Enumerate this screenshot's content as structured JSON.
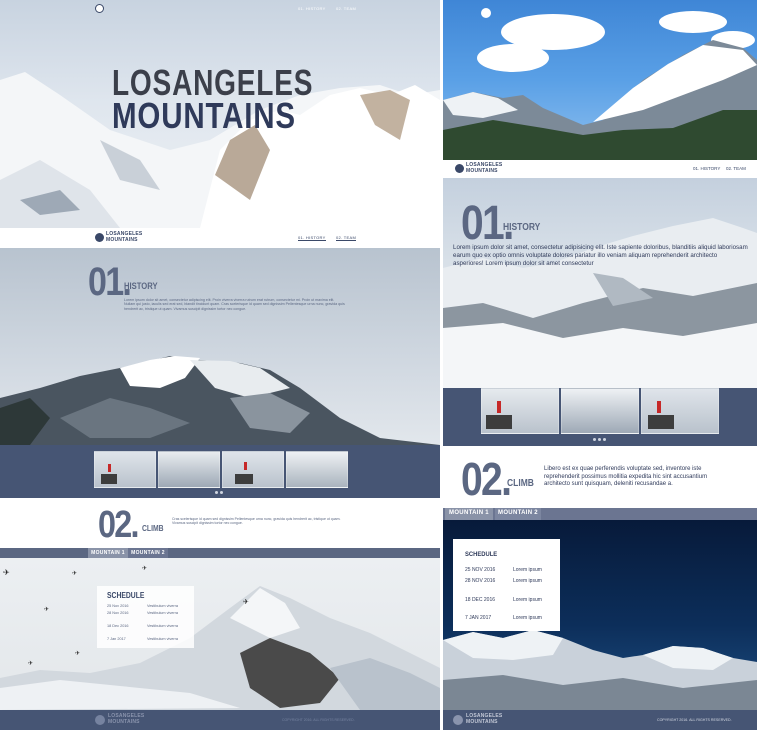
{
  "left": {
    "hero": {
      "title_line1": "LOSANGELES",
      "title_line2": "MOUNTAINS",
      "nav": [
        "01. HISTORY",
        "02. TEAM"
      ]
    },
    "header": {
      "logo_line1": "LOSANGELES",
      "logo_line2": "MOUNTAINS",
      "nav": [
        "01. HISTORY",
        "02. TEAM"
      ]
    },
    "history": {
      "number": "01.",
      "title": "HISTORY",
      "text": "Lorem ipsum dolor sit amet, consectetur adipiscing elit. Proin viverra viverra rutrum erat rutrum, consectetur mi. Proin ut maxima elit. Nullam qui justo, iaculis sed erat sed, blandit tincidunt quam. Cras scelerisque id quam sed dignissim Pellentesque urna nunc, gravida quis hendrerit ac, tristique ut quam. Vivamus suscipit dignissim tortor nec congue."
    },
    "climb": {
      "number": "02.",
      "title": "CLIMB",
      "text": "Cras scelerisque id quam sed dignissim Pellentesque urna nunc, gravida quis hendrerit ac, tristique ut quam. Vivamus suscipit dignissim tortor nec congue."
    },
    "tabs": [
      "MOUNTAIN 1",
      "MOUNTAIN 2"
    ],
    "schedule": {
      "title": "SCHEDULE",
      "rows": [
        {
          "date": "25 Nov 2016",
          "text": "Vestibulum viverra"
        },
        {
          "date": "28 Nov 2016",
          "text": "Vestibulum viverra"
        },
        {
          "date": "18 Dec 2016",
          "text": "Vestibulum viverra"
        },
        {
          "date": "7 Jan 2017",
          "text": "Vestibulum viverra"
        }
      ]
    },
    "footer": {
      "logo_line1": "LOSANGELES",
      "logo_line2": "MOUNTAINS",
      "copyright": "COPYRIGHT 2016. ALL RIGHTS RESERVED."
    }
  },
  "right": {
    "header": {
      "logo_line1": "LOSANGELES",
      "logo_line2": "MOUNTAINS",
      "nav": [
        "01. HISTORY",
        "02. TEAM"
      ]
    },
    "history": {
      "number": "01.",
      "title": "HISTORY",
      "text": "Lorem ipsum dolor sit amet, consectetur adipisicing elit. Iste sapiente doloribus, blanditiis aliquid laboriosam earum quo ex optio omnis voluptate dolores pariatur illo veniam aliquam reprehenderit architecto asperiores! Lorem ipsum dolor sit amet consectetur"
    },
    "climb": {
      "number": "02.",
      "title": "CLIMB",
      "text": "Libero est ex quae perferendis voluptate sed, inventore iste reprehenderit possimus mollitia expedita hic sint accusantium architecto sunt quisquam, deleniti recusandae a."
    },
    "tabs": [
      "MOUNTAIN 1",
      "MOUNTAIN 2"
    ],
    "schedule": {
      "title": "SCHEDULE",
      "rows": [
        {
          "date": "25 NOV 2016",
          "text": "Lorem ipsum"
        },
        {
          "date": "28 NOV 2016",
          "text": "Lorem ipsum"
        },
        {
          "date": "18 DEC 2016",
          "text": "Lorem ipsum"
        },
        {
          "date": "7 JAN 2017",
          "text": "Lorem ipsum"
        }
      ]
    },
    "footer": {
      "logo_line1": "LOSANGELES",
      "logo_line2": "MOUNTAINS",
      "copyright": "COPYRIGHT 2016. ALL RIGHTS RESERVED."
    }
  },
  "colors": {
    "navy": "#465574",
    "title_gray": "#5b6782",
    "hero_title_dark": "#2f3a5a"
  }
}
